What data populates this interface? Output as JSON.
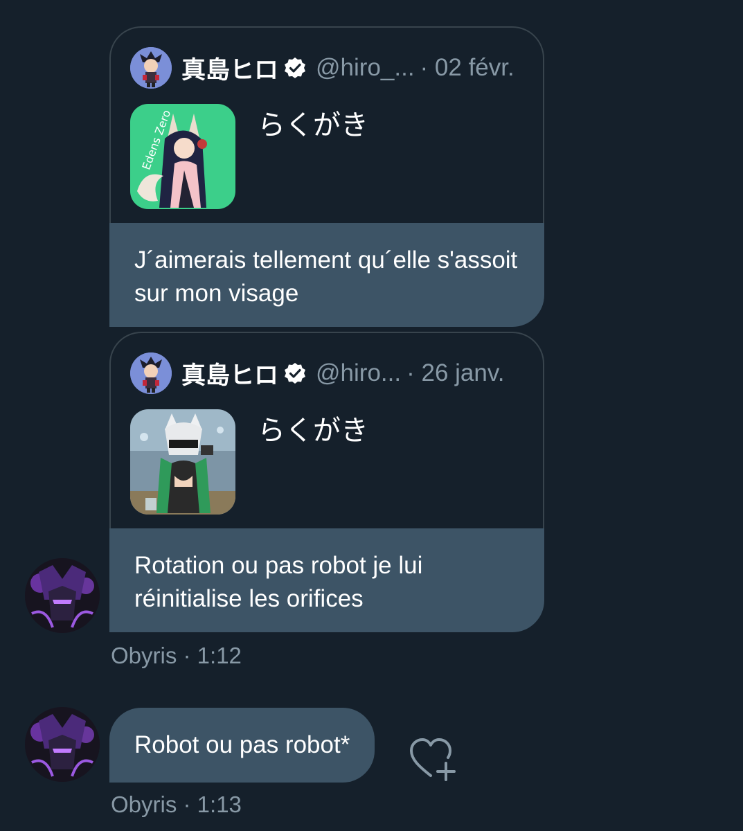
{
  "messages": [
    {
      "quote": {
        "name": "真島ヒロ",
        "handle": "@hiro_...",
        "date": "· 02 févr.",
        "text": "らくがき",
        "thumb_caption": "Edens Zero"
      },
      "reply": "J´aimerais tellement qu´elle s'assoit sur mon visage"
    },
    {
      "quote": {
        "name": "真島ヒロ",
        "handle": "@hiro...",
        "date": "· 26 janv.",
        "text": "らくがき"
      },
      "reply": "Rotation ou pas robot je lui réinitialise les orifices",
      "meta": "Obyris · 1:12"
    },
    {
      "reply": "Robot ou pas robot*",
      "meta": "Obyris · 1:13"
    }
  ],
  "colors": {
    "background": "#15202b",
    "bubble": "#3d5466",
    "border": "#38444d",
    "muted": "#8899a6"
  },
  "icons": [
    "verified-icon",
    "add-reaction-heart-icon"
  ]
}
